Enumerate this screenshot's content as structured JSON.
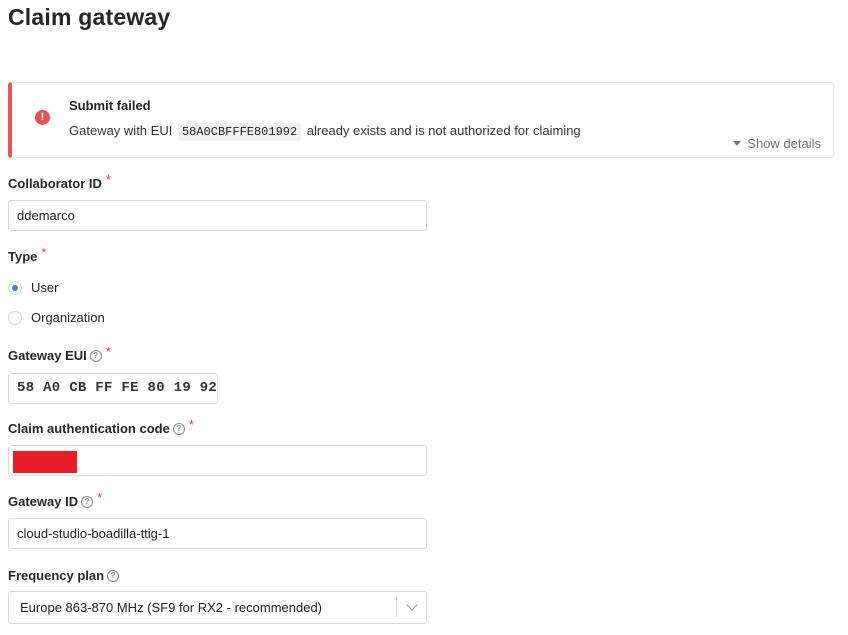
{
  "page": {
    "title": "Claim gateway"
  },
  "alert": {
    "icon": "exclamation-icon",
    "title": "Submit failed",
    "message_prefix": "Gateway with EUI",
    "message_code": "58A0CBFFFE801992",
    "message_suffix": "already exists and is not authorized for claiming",
    "show_details_label": "Show details",
    "color": "#ef5350"
  },
  "form": {
    "collaborator_id": {
      "label": "Collaborator ID",
      "required_mark": "*",
      "value": "ddemarco"
    },
    "type": {
      "label": "Type",
      "required_mark": "*",
      "options": [
        {
          "label": "User",
          "selected": true
        },
        {
          "label": "Organization",
          "selected": false
        }
      ]
    },
    "gateway_eui": {
      "label": "Gateway EUI",
      "required_mark": "*",
      "help_icon": "question-circle-icon",
      "value": "58 A0 CB FF FE 80 19 92"
    },
    "claim_auth_code": {
      "label": "Claim authentication code",
      "required_mark": "*",
      "help_icon": "question-circle-icon",
      "value_redacted": true
    },
    "gateway_id": {
      "label": "Gateway ID",
      "required_mark": "*",
      "help_icon": "question-circle-icon",
      "value": "cloud-studio-boadilla-ttig-1"
    },
    "frequency_plan": {
      "label": "Frequency plan",
      "help_icon": "question-circle-icon",
      "value": "Europe 863-870 MHz (SF9 for RX2 - recommended)"
    }
  },
  "colors": {
    "accent": "#3b82f6",
    "required": "#e53935",
    "redaction": "#ea1c24"
  }
}
